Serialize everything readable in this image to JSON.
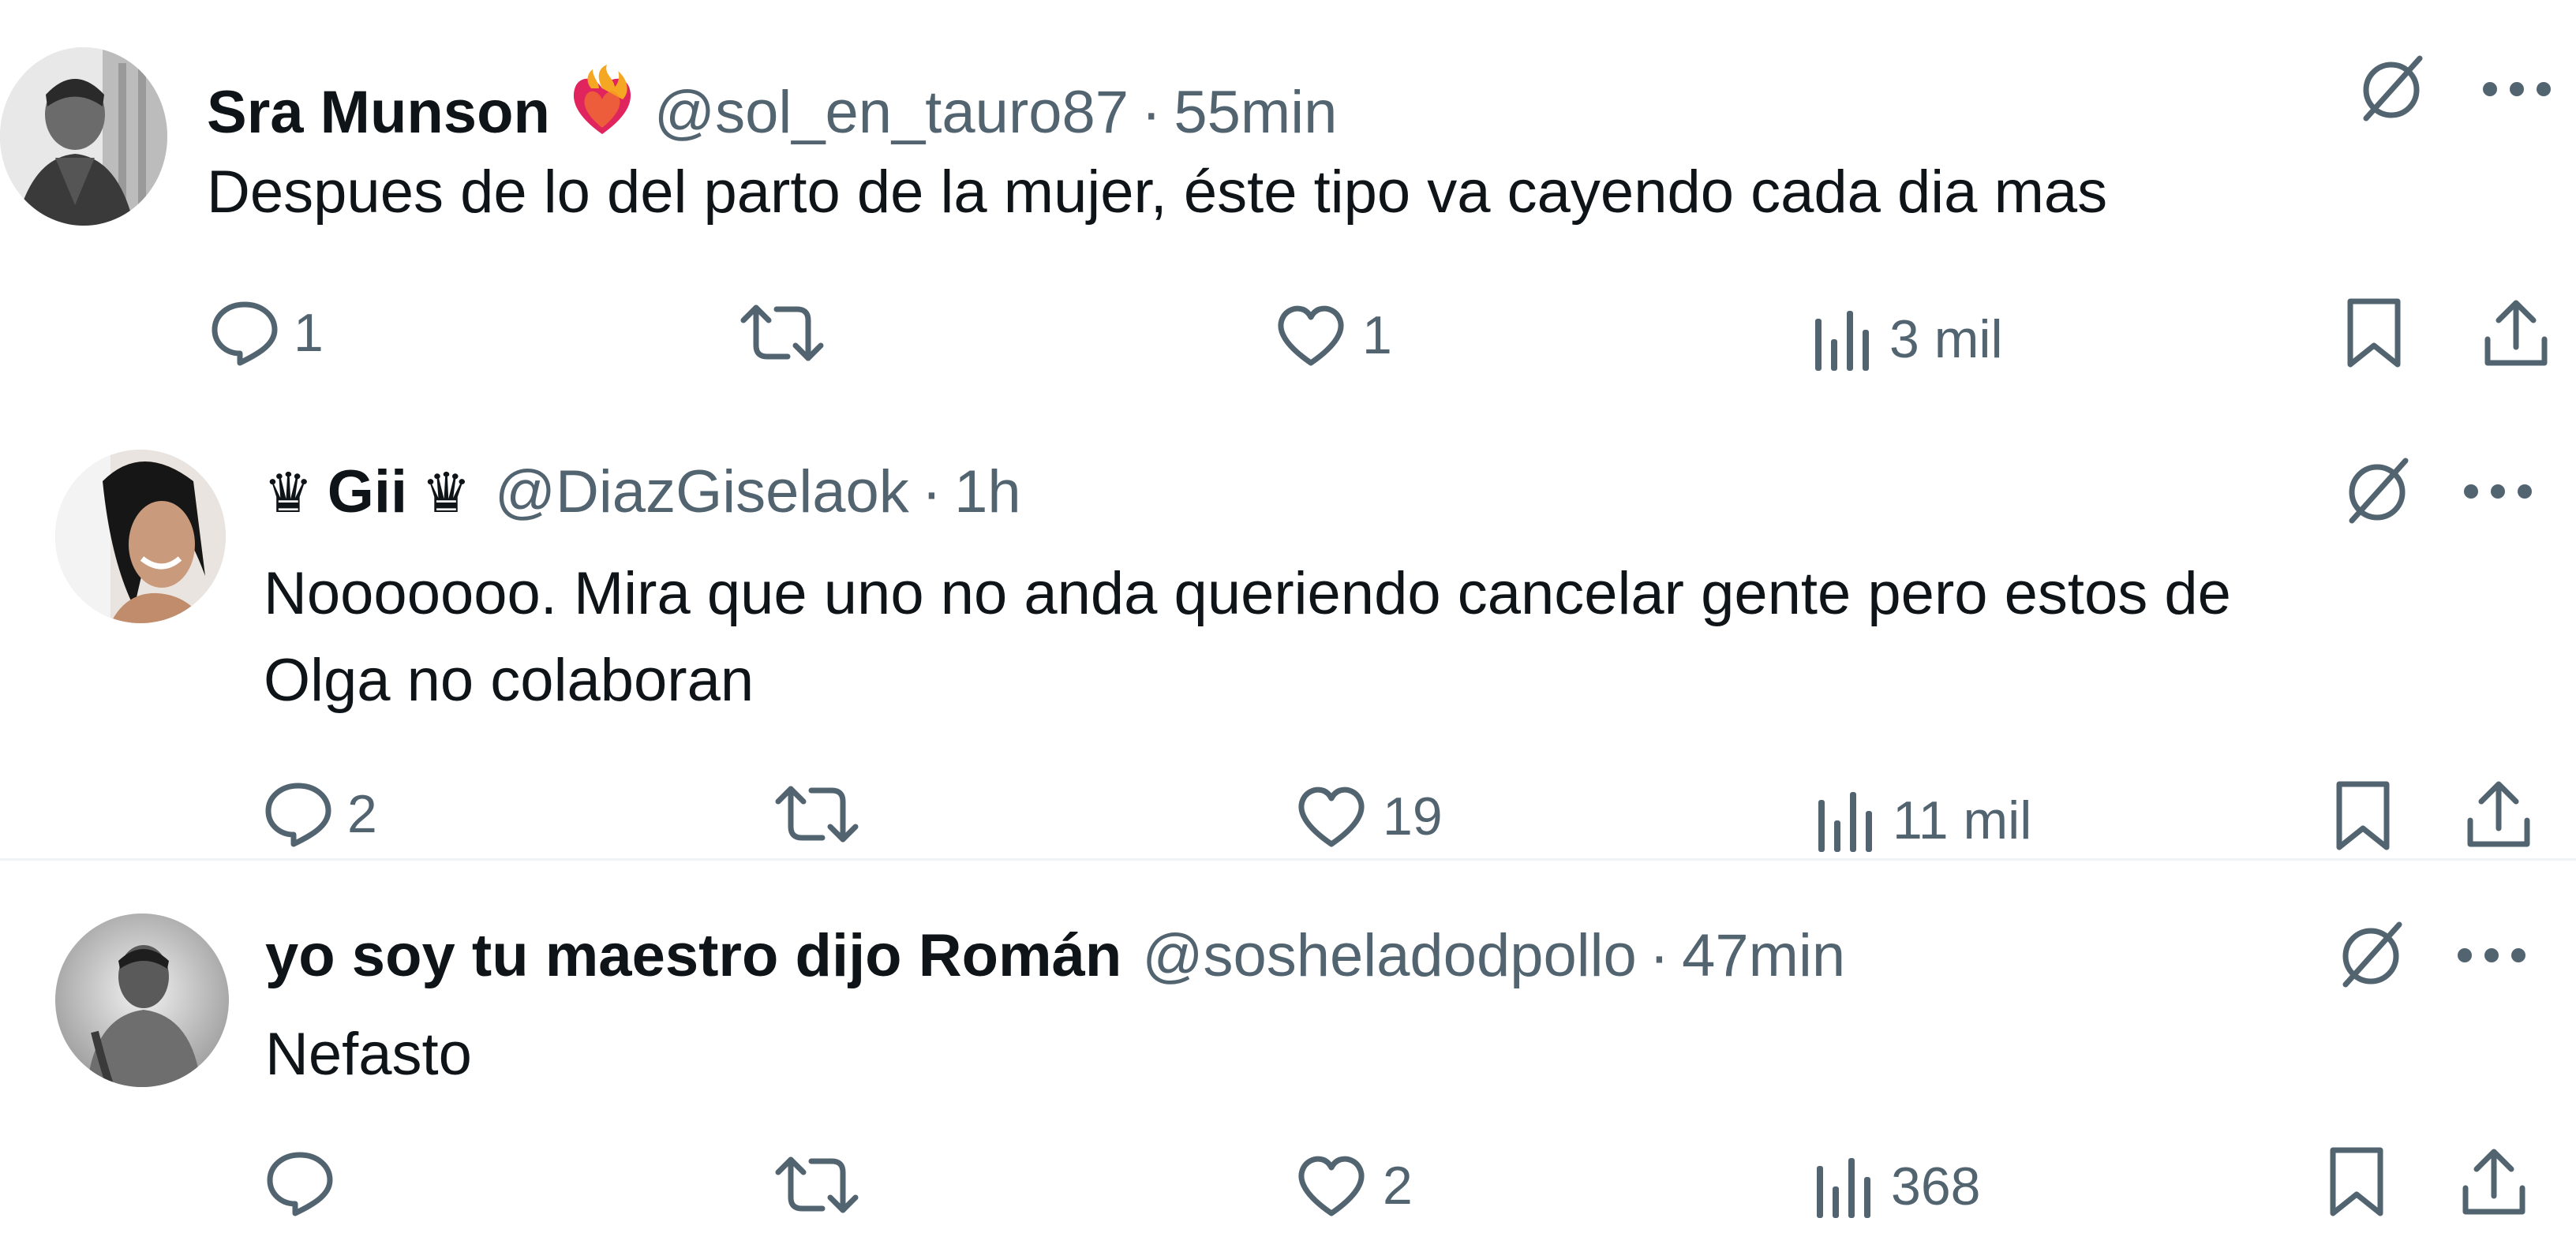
{
  "colors": {
    "text_primary": "#0f1419",
    "text_secondary": "#536471",
    "divider": "#eff3f4"
  },
  "tweets": [
    {
      "display_name": "Sra Munson",
      "name_emoji": "flaming-heart",
      "handle": "@sol_en_tauro87",
      "separator": "·",
      "timestamp": "55min",
      "text_lines": [
        "Despues de lo del parto de la mujer, éste tipo va cayendo cada dia mas"
      ],
      "replies": "1",
      "reposts": "",
      "likes": "1",
      "views": "3 mil"
    },
    {
      "display_name_prefix": "♛",
      "display_name": "Gii",
      "display_name_suffix": "♛",
      "handle": "@DiazGiselaok",
      "separator": "·",
      "timestamp": "1h",
      "text_lines": [
        "Nooooooo. Mira que uno no anda queriendo cancelar gente pero estos de",
        "Olga no colaboran"
      ],
      "replies": "2",
      "reposts": "",
      "likes": "19",
      "views": "11 mil"
    },
    {
      "display_name": "yo soy tu maestro dijo Román",
      "handle": "@sosheladodpollo",
      "separator": "·",
      "timestamp": "47min",
      "text_lines": [
        "Nefasto"
      ],
      "replies": "",
      "reposts": "",
      "likes": "2",
      "views": "368"
    }
  ],
  "icons": {
    "grok": "grok-icon",
    "more": "more-icon",
    "reply": "reply-icon",
    "repost": "repost-icon",
    "like": "like-icon",
    "views": "views-icon",
    "bookmark": "bookmark-icon",
    "share": "share-icon"
  }
}
